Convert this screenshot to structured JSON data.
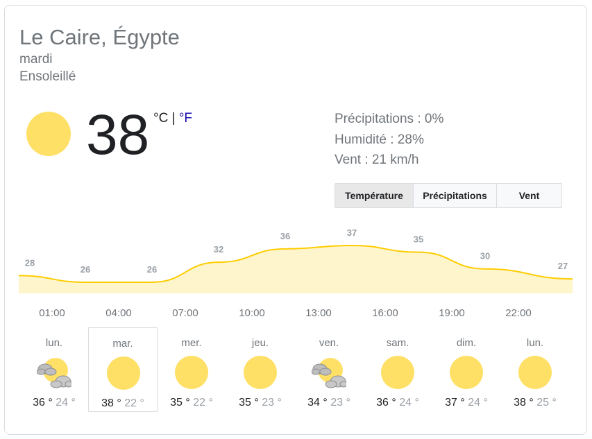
{
  "location": "Le Caire, Égypte",
  "day": "mardi",
  "condition": "Ensoleillé",
  "current": {
    "temp": "38",
    "unit_c": "°C",
    "separator": "|",
    "unit_f": "°F",
    "icon": "sun-icon"
  },
  "details": {
    "precipitation": "Précipitations : 0%",
    "humidity": "Humidité : 28%",
    "wind": "Vent : 21 km/h"
  },
  "tabs": [
    "Température",
    "Précipitations",
    "Vent"
  ],
  "chart_data": {
    "type": "area",
    "x": [
      "01:00",
      "04:00",
      "07:00",
      "10:00",
      "13:00",
      "16:00",
      "19:00",
      "22:00"
    ],
    "values": [
      28,
      26,
      26,
      32,
      36,
      37,
      35,
      30,
      27
    ],
    "value_times": [
      "01:00",
      "04:00",
      "07:00",
      "10:00",
      "13:00",
      "16:00",
      "19:00",
      "22:00",
      "01:00"
    ],
    "line_color": "#ffcc00",
    "fill_color": "#fff5cc"
  },
  "forecast": [
    {
      "day": "lun.",
      "icon": "partly-cloudy-icon",
      "hi": "36 °",
      "lo": "24 °"
    },
    {
      "day": "mar.",
      "icon": "sun-icon",
      "hi": "38 °",
      "lo": "22 °"
    },
    {
      "day": "mer.",
      "icon": "sun-icon",
      "hi": "35 °",
      "lo": "22 °"
    },
    {
      "day": "jeu.",
      "icon": "sun-icon",
      "hi": "35 °",
      "lo": "23 °"
    },
    {
      "day": "ven.",
      "icon": "partly-cloudy-icon",
      "hi": "34 °",
      "lo": "23 °"
    },
    {
      "day": "sam.",
      "icon": "sun-icon",
      "hi": "36 °",
      "lo": "24 °"
    },
    {
      "day": "dim.",
      "icon": "sun-icon",
      "hi": "37 °",
      "lo": "24 °"
    },
    {
      "day": "lun.",
      "icon": "sun-icon",
      "hi": "38 °",
      "lo": "25 °"
    }
  ],
  "colors": {
    "sun": "#ffe066",
    "accent_link": "#1a0dab",
    "text_secondary": "#70757a"
  }
}
